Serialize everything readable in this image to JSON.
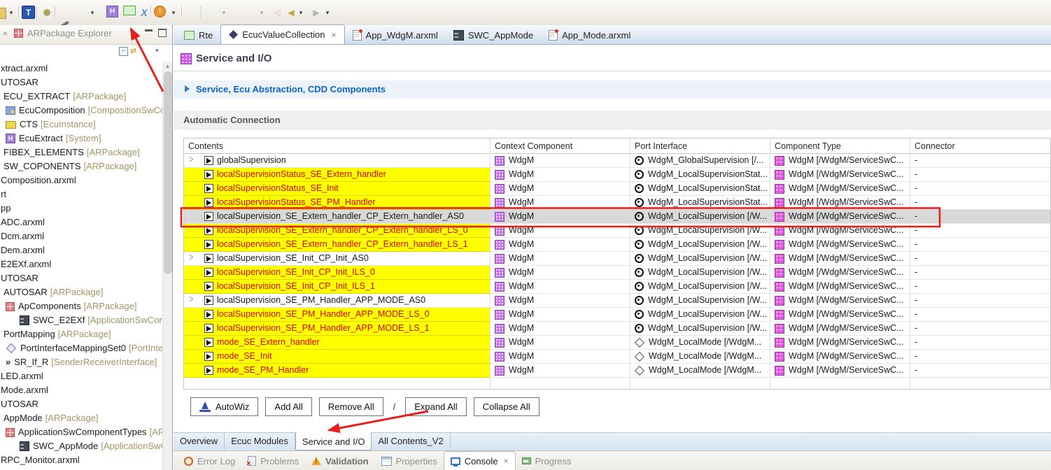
{
  "toolbar": {
    "icons": [
      "toolbar-partial-icon",
      "toolbar-overflow-dropdown",
      "new-type-button",
      "goto-star-button",
      "disconnect-pen-button",
      "import-tray-button",
      "import-tray-dropdown",
      "ecu-extract-button",
      "green-block-button",
      "xsd-button",
      "alert-button",
      "alert-dropdown",
      "gears-button",
      "save-page-button",
      "save-page-dropdown",
      "load-page-button",
      "load-page-dropdown",
      "nav-back-faded-button",
      "nav-back-button",
      "nav-back-dropdown",
      "nav-forward-button",
      "nav-forward-dropdown"
    ]
  },
  "sidebar": {
    "title": "ARPackage Explorer",
    "tree": [
      {
        "t": "xtract.arxml"
      },
      {
        "t": "UTOSAR"
      },
      {
        "t": "ECU_EXTRACT",
        "s": " [ARPackage]",
        "pkg": true
      },
      {
        "t": "EcuComposition",
        "s": " [CompositionSwCo",
        "icon": "composition",
        "ind": 1
      },
      {
        "t": "CTS",
        "s": " [EcuInstance]",
        "icon": "ecu",
        "ind": 1
      },
      {
        "t": "EcuExtract",
        "s": " [System]",
        "icon": "system",
        "ind": 1
      },
      {
        "t": "FIBEX_ELEMENTS",
        "s": " [ARPackage]",
        "pkg": true
      },
      {
        "t": "SW_COPONENTS",
        "s": " [ARPackage]",
        "pkg": true
      },
      {
        "t": "Composition.arxml"
      },
      {
        "t": "rt"
      },
      {
        "t": "pp"
      },
      {
        "t": "ADC.arxml"
      },
      {
        "t": "Dcm.arxml"
      },
      {
        "t": "Dem.arxml"
      },
      {
        "t": "E2EXf.arxml"
      },
      {
        "t": "UTOSAR"
      },
      {
        "t": "AUTOSAR",
        "s": " [ARPackage]",
        "pkg": true
      },
      {
        "t": "ApComponents",
        "s": " [ARPackage]",
        "icon": "package",
        "ind": 1
      },
      {
        "t": "SWC_E2EXf",
        "s": " [ApplicationSwCompo",
        "icon": "swc",
        "ind": 2
      },
      {
        "t": "PortMapping",
        "s": " [ARPackage]",
        "pkg": true
      },
      {
        "t": "PortInterfaceMappingSet0",
        "s": " [PortInte",
        "icon": "mapping",
        "ind": 1
      },
      {
        "t": "SR_If_R",
        "s": " [SenderReceiverInterface]",
        "icon": "sr",
        "ind": 1
      },
      {
        "t": "LED.arxml"
      },
      {
        "t": "Mode.arxml"
      },
      {
        "t": "UTOSAR"
      },
      {
        "t": "AppMode",
        "s": " [ARPackage]",
        "pkg": true
      },
      {
        "t": "ApplicationSwComponentTypes",
        "s": " [AR",
        "icon": "package",
        "ind": 1
      },
      {
        "t": "SWC_AppMode",
        "s": " [ApplicationSwCo",
        "icon": "swc",
        "ind": 2
      },
      {
        "t": "RPC_Monitor.arxml"
      }
    ]
  },
  "editor_tabs": [
    {
      "label": "Rte",
      "icon": "green-block"
    },
    {
      "label": "EcucValueCollection",
      "icon": "diamond",
      "active": true,
      "closable": true
    },
    {
      "label": "App_WdgM.arxml",
      "icon": "arxml-file"
    },
    {
      "label": "SWC_AppMode",
      "icon": "swc"
    },
    {
      "label": "App_Mode.arxml",
      "icon": "arxml-file"
    }
  ],
  "page": {
    "title": "Service and I/O",
    "section_link": "Service, Ecu Abstraction, CDD Components",
    "section_auto": "Automatic Connection"
  },
  "table": {
    "columns": [
      "Contents",
      "Context Component",
      "Port Interface",
      "Component Type",
      "Connector"
    ],
    "rows": [
      {
        "content": "globalSupervision",
        "state": "white",
        "expandable": true,
        "context": "WdgM",
        "port": "WdgM_GlobalSupervision [/...",
        "port_icon": "port",
        "component": "WdgM [/WdgM/ServiceSwC...",
        "connector": "-"
      },
      {
        "content": "localSupervisionStatus_SE_Extern_handler",
        "state": "yellow",
        "context": "WdgM",
        "port": "WdgM_LocalSupervisionStat...",
        "port_icon": "port",
        "component": "WdgM [/WdgM/ServiceSwC...",
        "connector": "-"
      },
      {
        "content": "localSupervisionStatus_SE_Init",
        "state": "yellow",
        "context": "WdgM",
        "port": "WdgM_LocalSupervisionStat...",
        "port_icon": "port",
        "component": "WdgM [/WdgM/ServiceSwC...",
        "connector": "-"
      },
      {
        "content": "localSupervisionStatus_SE_PM_Handler",
        "state": "yellow",
        "context": "WdgM",
        "port": "WdgM_LocalSupervisionStat...",
        "port_icon": "port",
        "component": "WdgM [/WdgM/ServiceSwC...",
        "connector": "-"
      },
      {
        "content": "localSupervision_SE_Extern_handler_CP_Extern_handler_AS0",
        "state": "selected",
        "context": "WdgM",
        "port": "WdgM_LocalSupervision [/W...",
        "port_icon": "port",
        "component": "WdgM [/WdgM/ServiceSwC...",
        "connector": "-"
      },
      {
        "content": "localSupervision_SE_Extern_handler_CP_Extern_handler_LS_0",
        "state": "yellow",
        "context": "WdgM",
        "port": "WdgM_LocalSupervision [/W...",
        "port_icon": "port",
        "component": "WdgM [/WdgM/ServiceSwC...",
        "connector": "-"
      },
      {
        "content": "localSupervision_SE_Extern_handler_CP_Extern_handler_LS_1",
        "state": "yellow",
        "context": "WdgM",
        "port": "WdgM_LocalSupervision [/W...",
        "port_icon": "port",
        "component": "WdgM [/WdgM/ServiceSwC...",
        "connector": "-"
      },
      {
        "content": "localSupervision_SE_Init_CP_Init_AS0",
        "state": "white",
        "expandable": true,
        "context": "WdgM",
        "port": "WdgM_LocalSupervision [/W...",
        "port_icon": "port",
        "component": "WdgM [/WdgM/ServiceSwC...",
        "connector": "-"
      },
      {
        "content": "localSupervision_SE_Init_CP_Init_ILS_0",
        "state": "yellow",
        "context": "WdgM",
        "port": "WdgM_LocalSupervision [/W...",
        "port_icon": "port",
        "component": "WdgM [/WdgM/ServiceSwC...",
        "connector": "-"
      },
      {
        "content": "localSupervision_SE_Init_CP_Init_ILS_1",
        "state": "yellow",
        "context": "WdgM",
        "port": "WdgM_LocalSupervision [/W...",
        "port_icon": "port",
        "component": "WdgM [/WdgM/ServiceSwC...",
        "connector": "-"
      },
      {
        "content": "localSupervision_SE_PM_Handler_APP_MODE_AS0",
        "state": "white",
        "expandable": true,
        "context": "WdgM",
        "port": "WdgM_LocalSupervision [/W...",
        "port_icon": "port",
        "component": "WdgM [/WdgM/ServiceSwC...",
        "connector": "-"
      },
      {
        "content": "localSupervision_SE_PM_Handler_APP_MODE_LS_0",
        "state": "yellow",
        "context": "WdgM",
        "port": "WdgM_LocalSupervision [/W...",
        "port_icon": "port",
        "component": "WdgM [/WdgM/ServiceSwC...",
        "connector": "-"
      },
      {
        "content": "localSupervision_SE_PM_Handler_APP_MODE_LS_1",
        "state": "yellow",
        "context": "WdgM",
        "port": "WdgM_LocalSupervision [/W...",
        "port_icon": "port",
        "component": "WdgM [/WdgM/ServiceSwC...",
        "connector": "-"
      },
      {
        "content": "mode_SE_Extern_handler",
        "state": "yellow",
        "context": "WdgM",
        "port": "WdgM_LocalMode [/WdgM...",
        "port_icon": "mode",
        "component": "WdgM [/WdgM/ServiceSwC...",
        "connector": "-"
      },
      {
        "content": "mode_SE_Init",
        "state": "yellow",
        "context": "WdgM",
        "port": "WdgM_LocalMode [/WdgM...",
        "port_icon": "mode",
        "component": "WdgM [/WdgM/ServiceSwC...",
        "connector": "-"
      },
      {
        "content": "mode_SE_PM_Handler",
        "state": "yellow",
        "context": "WdgM",
        "port": "WdgM_LocalMode [/WdgM...",
        "port_icon": "mode",
        "component": "WdgM [/WdgM/ServiceSwC...",
        "connector": "-"
      }
    ]
  },
  "buttons": {
    "autowiz": "AutoWiz",
    "add_all": "Add All",
    "remove_all": "Remove All",
    "slash": "/",
    "expand_all": "Expand All",
    "collapse_all": "Collapse All"
  },
  "form_tabs": [
    {
      "label": "Overview"
    },
    {
      "label": "Ecuc Modules"
    },
    {
      "label": "Service and I/O",
      "active": true
    },
    {
      "label": "All Contents_V2"
    }
  ],
  "console_tabs": [
    {
      "label": "Error Log",
      "icon": "error-log"
    },
    {
      "label": "Problems",
      "icon": "problems"
    },
    {
      "label": "Validation",
      "icon": "validation",
      "bold": true
    },
    {
      "label": "Properties",
      "icon": "properties"
    },
    {
      "label": "Console",
      "icon": "console",
      "active": true,
      "closable": true
    },
    {
      "label": "Progress",
      "icon": "progress"
    }
  ],
  "colors": {
    "highlight_yellow": "#ffff00",
    "highlight_text_red": "#e00000",
    "selection_gray": "#d9d9d9",
    "link_blue": "#0a64c8",
    "annotation_red": "#e8201c"
  }
}
